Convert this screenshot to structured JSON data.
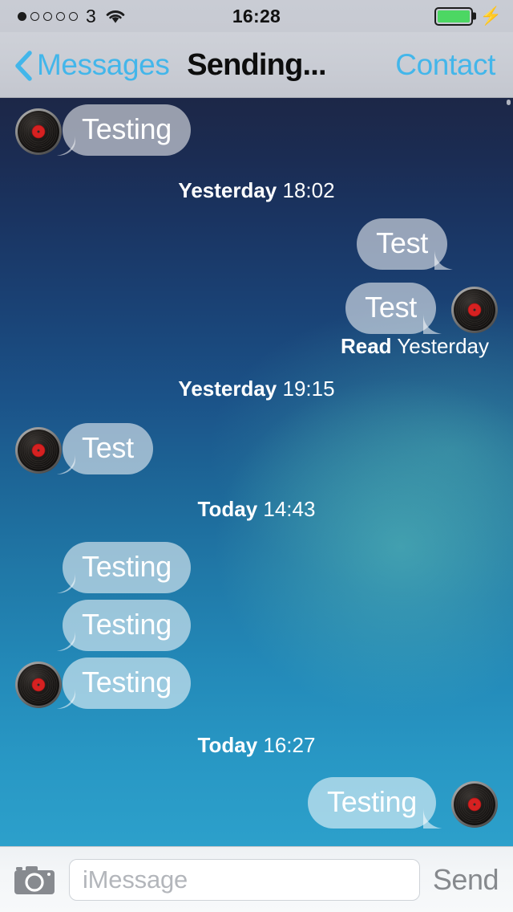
{
  "status_bar": {
    "signal_dots_total": 5,
    "signal_dots_filled": 1,
    "carrier": "3",
    "wifi_icon": "wifi-icon",
    "time": "16:28",
    "battery_level_percent": 100,
    "battery_color": "#4cd763",
    "charging": true,
    "charging_icon": "lightning-bolt-icon"
  },
  "nav_bar": {
    "back_icon": "chevron-left-icon",
    "back_label": "Messages",
    "title": "Sending...",
    "right_label": "Contact",
    "accent_color": "#43b6ea"
  },
  "conversation": {
    "avatar_icon": "vinyl-record-avatar",
    "messages": [
      {
        "id": "m1",
        "direction": "in",
        "text": "Testing",
        "show_avatar": true
      },
      {
        "id": "t1",
        "type": "timestamp",
        "day": "Yesterday",
        "time": "18:02"
      },
      {
        "id": "m2",
        "direction": "out",
        "text": "Test",
        "show_avatar": false
      },
      {
        "id": "m3",
        "direction": "out",
        "text": "Test",
        "show_avatar": true,
        "delivery_status": "Read",
        "delivery_time": "Yesterday"
      },
      {
        "id": "t2",
        "type": "timestamp",
        "day": "Yesterday",
        "time": "19:15"
      },
      {
        "id": "m4",
        "direction": "in",
        "text": "Test",
        "show_avatar": true
      },
      {
        "id": "t3",
        "type": "timestamp",
        "day": "Today",
        "time": "14:43"
      },
      {
        "id": "m5",
        "direction": "in",
        "text": "Testing",
        "show_avatar": false
      },
      {
        "id": "m6",
        "direction": "in",
        "text": "Testing",
        "show_avatar": false
      },
      {
        "id": "m7",
        "direction": "in",
        "text": "Testing",
        "show_avatar": true
      },
      {
        "id": "t4",
        "type": "timestamp",
        "day": "Today",
        "time": "16:27"
      },
      {
        "id": "m8",
        "direction": "out",
        "text": "Testing",
        "show_avatar": true
      }
    ],
    "bubble_fill": "rgba(255,255,255,0.55)",
    "text_color": "#ffffff"
  },
  "input_bar": {
    "camera_icon": "camera-icon",
    "input_value": "",
    "input_placeholder": "iMessage",
    "send_label": "Send",
    "send_enabled": false
  },
  "msg": {
    "m1": {
      "text": "Testing"
    },
    "m2": {
      "text": "Test"
    },
    "m3": {
      "text": "Test",
      "status": "Read",
      "status_time": "Yesterday"
    },
    "m4": {
      "text": "Test"
    },
    "m5": {
      "text": "Testing"
    },
    "m6": {
      "text": "Testing"
    },
    "m7": {
      "text": "Testing"
    },
    "m8": {
      "text": "Testing"
    },
    "t1": {
      "day": "Yesterday",
      "time": "18:02"
    },
    "t2": {
      "day": "Yesterday",
      "time": "19:15"
    },
    "t3": {
      "day": "Today",
      "time": "14:43"
    },
    "t4": {
      "day": "Today",
      "time": "16:27"
    }
  }
}
